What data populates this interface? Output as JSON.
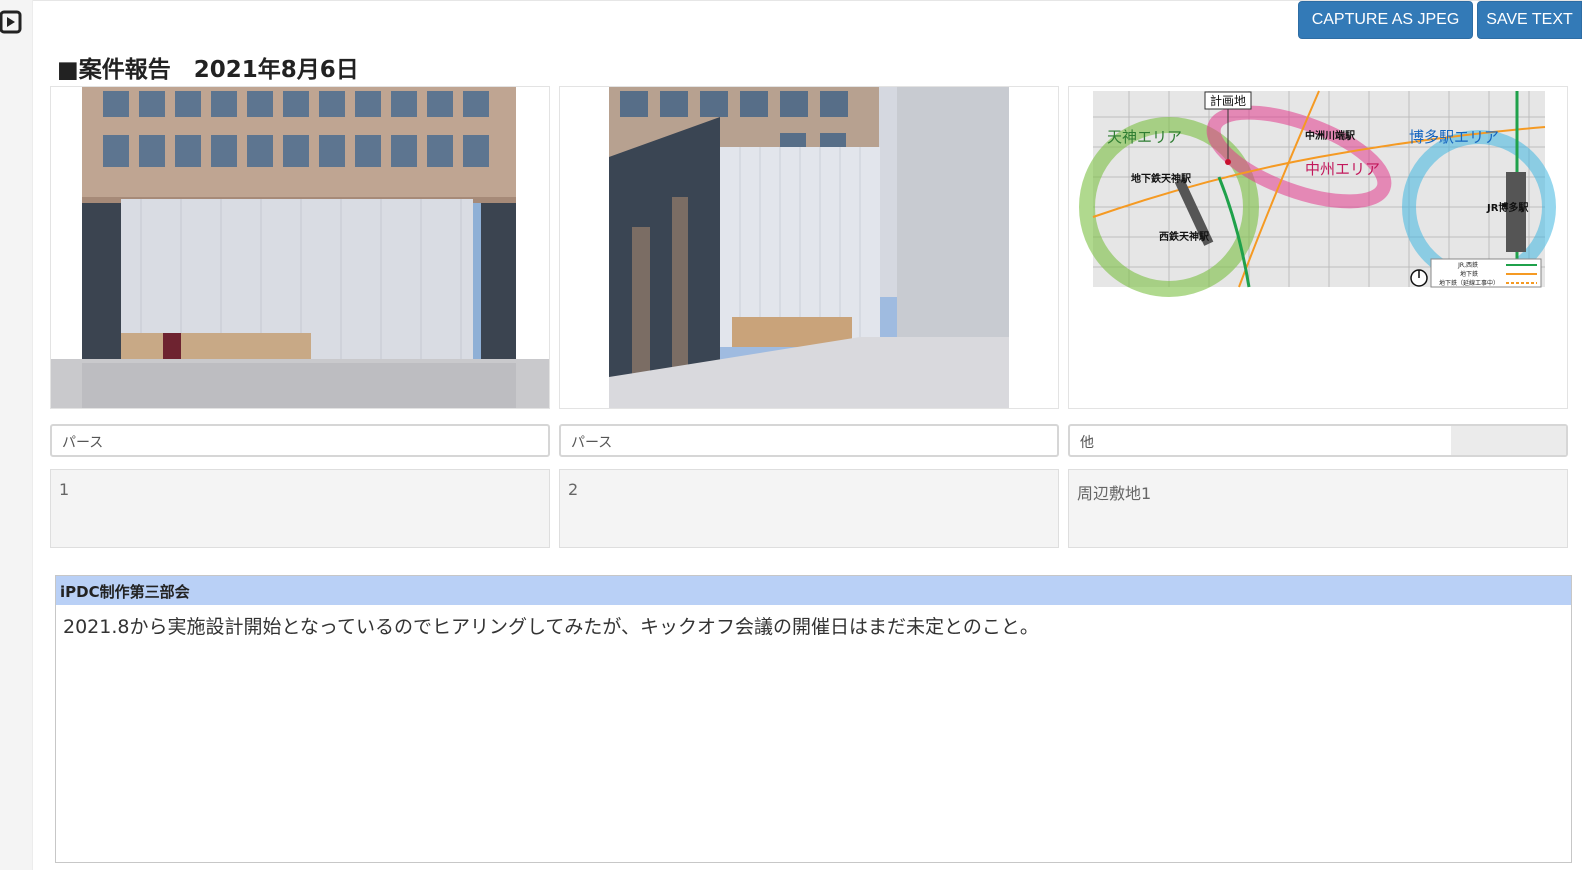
{
  "toolbar": {
    "capture_label": "CAPTURE AS JPEG",
    "save_label": "SAVE TEXT"
  },
  "page": {
    "title": "■案件報告　2021年8月6日"
  },
  "cards": [
    {
      "caption": "パース",
      "note": "1"
    },
    {
      "caption": "パース",
      "note": "2"
    },
    {
      "caption": "他",
      "note": "周辺敷地1"
    }
  ],
  "map": {
    "site_label": "計画地",
    "areas": [
      "天神エリア",
      "中州エリア",
      "博多駅エリア"
    ],
    "stations": [
      "中洲川端駅",
      "地下鉄天神駅",
      "西鉄天神駅",
      "JR博多駅"
    ],
    "legend": [
      "JR,西鉄",
      "地下鉄",
      "地下鉄（延線工事中）"
    ],
    "colors": {
      "tenjin": "#7cc043",
      "nakasu": "#e23b8c",
      "hakata": "#3fb6e0",
      "jr": "#1fa14b",
      "subway": "#f59a23"
    }
  },
  "comment": {
    "author": "iPDC制作第三部会",
    "text": "2021.8から実施設計開始となっているのでヒアリングしてみたが、キックオフ会議の開催日はまだ未定とのこと。"
  },
  "icons": {
    "sidebar_toggle": "play-icon"
  }
}
